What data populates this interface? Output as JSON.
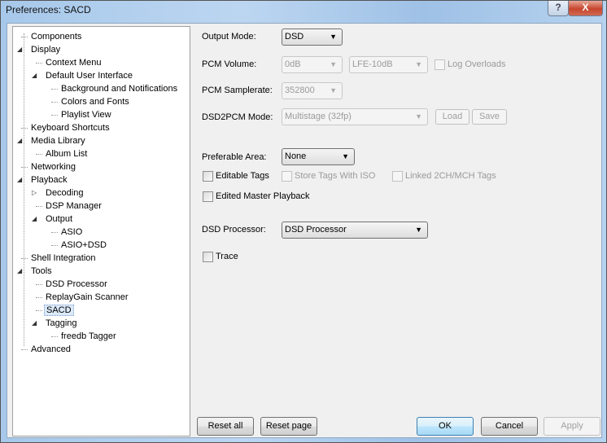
{
  "window": {
    "title": "Preferences: SACD",
    "help_label": "?",
    "close_label": "X"
  },
  "tree": [
    {
      "label": "Components",
      "level": 0,
      "exp": false
    },
    {
      "label": "Display",
      "level": 0,
      "exp": true
    },
    {
      "label": "Context Menu",
      "level": 1,
      "exp": false
    },
    {
      "label": "Default User Interface",
      "level": 1,
      "exp": true
    },
    {
      "label": "Background and Notifications",
      "level": 2,
      "exp": false
    },
    {
      "label": "Colors and Fonts",
      "level": 2,
      "exp": false
    },
    {
      "label": "Playlist View",
      "level": 2,
      "exp": false
    },
    {
      "label": "Keyboard Shortcuts",
      "level": 0,
      "exp": false
    },
    {
      "label": "Media Library",
      "level": 0,
      "exp": true
    },
    {
      "label": "Album List",
      "level": 1,
      "exp": false
    },
    {
      "label": "Networking",
      "level": 0,
      "exp": false
    },
    {
      "label": "Playback",
      "level": 0,
      "exp": true
    },
    {
      "label": "Decoding",
      "level": 1,
      "exp": "collapsed"
    },
    {
      "label": "DSP Manager",
      "level": 1,
      "exp": false
    },
    {
      "label": "Output",
      "level": 1,
      "exp": true
    },
    {
      "label": "ASIO",
      "level": 2,
      "exp": false
    },
    {
      "label": "ASIO+DSD",
      "level": 2,
      "exp": false
    },
    {
      "label": "Shell Integration",
      "level": 0,
      "exp": false
    },
    {
      "label": "Tools",
      "level": 0,
      "exp": true
    },
    {
      "label": "DSD Processor",
      "level": 1,
      "exp": false
    },
    {
      "label": "ReplayGain Scanner",
      "level": 1,
      "exp": false
    },
    {
      "label": "SACD",
      "level": 1,
      "exp": false,
      "selected": true
    },
    {
      "label": "Tagging",
      "level": 1,
      "exp": true
    },
    {
      "label": "freedb Tagger",
      "level": 2,
      "exp": false
    },
    {
      "label": "Advanced",
      "level": 0,
      "exp": false
    }
  ],
  "form": {
    "output_mode": {
      "label": "Output Mode:",
      "value": "DSD"
    },
    "pcm_volume": {
      "label": "PCM Volume:",
      "value": "0dB",
      "lfe": "LFE-10dB",
      "log_overloads": "Log Overloads"
    },
    "pcm_samplerate": {
      "label": "PCM Samplerate:",
      "value": "352800"
    },
    "dsd2pcm_mode": {
      "label": "DSD2PCM Mode:",
      "value": "Multistage (32fp)",
      "load": "Load",
      "save": "Save"
    },
    "preferable_area": {
      "label": "Preferable Area:",
      "value": "None"
    },
    "editable_tags": "Editable Tags",
    "store_tags_iso": "Store Tags With ISO",
    "linked_tags": "Linked 2CH/MCH Tags",
    "edited_master": "Edited Master Playback",
    "dsd_processor": {
      "label": "DSD Processor:",
      "value": "DSD Processor"
    },
    "trace": "Trace"
  },
  "buttons": {
    "reset_all": "Reset all",
    "reset_page": "Reset page",
    "ok": "OK",
    "cancel": "Cancel",
    "apply": "Apply"
  }
}
